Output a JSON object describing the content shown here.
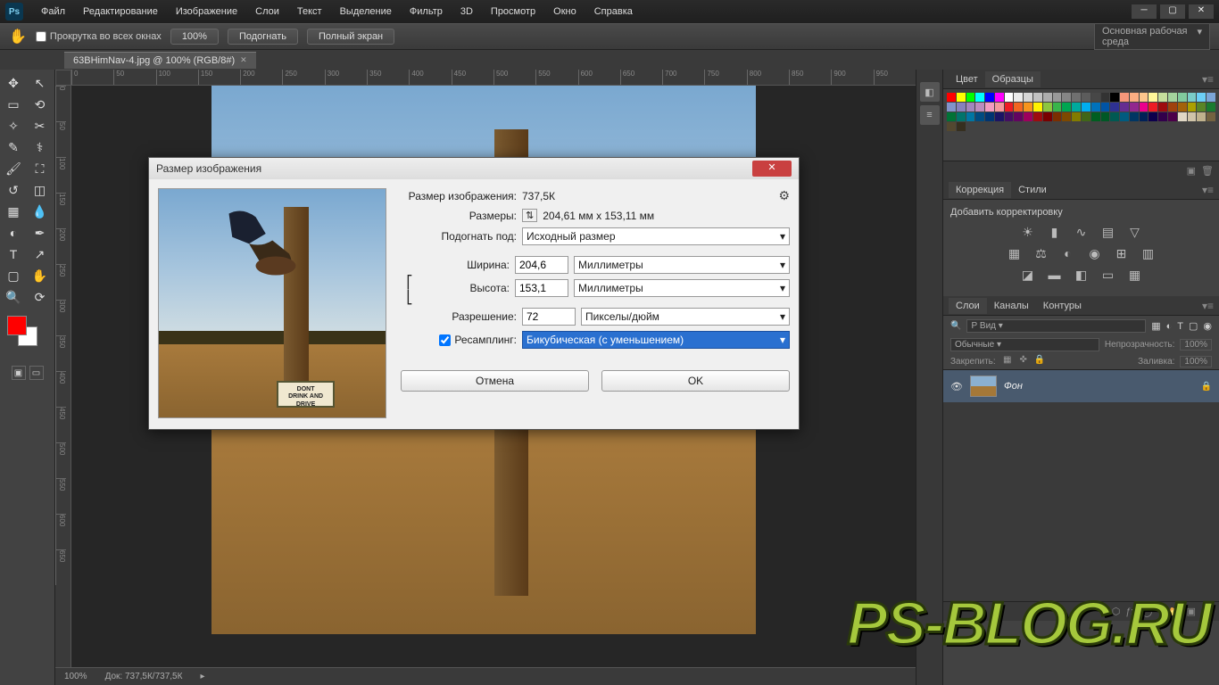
{
  "menubar": {
    "items": [
      "Файл",
      "Редактирование",
      "Изображение",
      "Слои",
      "Текст",
      "Выделение",
      "Фильтр",
      "3D",
      "Просмотр",
      "Окно",
      "Справка"
    ]
  },
  "optionsbar": {
    "scroll_all": "Прокрутка во всех окнах",
    "zoom_pct": "100%",
    "fit": "Подогнать",
    "fullscreen": "Полный экран",
    "workspace": "Основная рабочая среда"
  },
  "doctab": {
    "title": "63BHimNav-4.jpg @ 100% (RGB/8#)"
  },
  "statusbar": {
    "zoom": "100%",
    "doc": "Док: 737,5К/737,5К"
  },
  "panels": {
    "color_tabs": [
      "Цвет",
      "Образцы"
    ],
    "adjust_tabs": [
      "Коррекция",
      "Стили"
    ],
    "adjust_label": "Добавить корректировку",
    "layers_tabs": [
      "Слои",
      "Каналы",
      "Контуры"
    ],
    "layers": {
      "filter": "Р Вид",
      "blend": "Обычные",
      "opacity_label": "Непрозрачность:",
      "opacity": "100%",
      "lock_label": "Закрепить:",
      "fill_label": "Заливка:",
      "fill": "100%",
      "layer0": "Фон"
    }
  },
  "dialog": {
    "title": "Размер изображения",
    "size_label": "Размер изображения:",
    "size_val": "737,5К",
    "dims_label": "Размеры:",
    "dims_val": "204,61 мм x 153,11 мм",
    "fitto_label": "Подогнать под:",
    "fitto_val": "Исходный размер",
    "width_label": "Ширина:",
    "width_val": "204,6",
    "width_unit": "Миллиметры",
    "height_label": "Высота:",
    "height_val": "153,1",
    "height_unit": "Миллиметры",
    "res_label": "Разрешение:",
    "res_val": "72",
    "res_unit": "Пикселы/дюйм",
    "resample_label": "Ресамплинг:",
    "resample_val": "Бикубическая (с уменьшением)",
    "cancel": "Отмена",
    "ok": "OK"
  },
  "image_sign": "DONT\nDRINK AND\nDRIVE",
  "watermark": "PS-BLOG.RU",
  "swatch_colors": [
    "#ff0000",
    "#ffff00",
    "#00ff00",
    "#00ffff",
    "#0000ff",
    "#ff00ff",
    "#ffffff",
    "#ebebeb",
    "#d6d6d6",
    "#c2c2c2",
    "#adadad",
    "#999999",
    "#858585",
    "#707070",
    "#5c5c5c",
    "#474747",
    "#333333",
    "#000000",
    "#f7977a",
    "#fbad82",
    "#fdc68c",
    "#fff799",
    "#c6df9c",
    "#a4d49d",
    "#81ca9d",
    "#7accc8",
    "#6ccff7",
    "#7ca6d8",
    "#8293ca",
    "#8781bd",
    "#a286bd",
    "#bc8cbf",
    "#f49bc1",
    "#f5999d",
    "#ee1c24",
    "#f26522",
    "#f7941d",
    "#fff200",
    "#8cc63f",
    "#39b54a",
    "#00a651",
    "#00a99d",
    "#00aeef",
    "#0072bc",
    "#0054a6",
    "#2e3192",
    "#662d91",
    "#92278f",
    "#ec008c",
    "#ed1c24",
    "#9e0b0f",
    "#a0410d",
    "#a36209",
    "#aba000",
    "#598527",
    "#1a7b30",
    "#007236",
    "#00746b",
    "#0076a3",
    "#004b80",
    "#003471",
    "#1b1464",
    "#440e62",
    "#630460",
    "#9e005d",
    "#9e0b0f",
    "#790000",
    "#7b2e00",
    "#7d4900",
    "#827b00",
    "#406618",
    "#005e20",
    "#005826",
    "#005952",
    "#005b7f",
    "#003663",
    "#002157",
    "#0d004c",
    "#32004b",
    "#4b0049",
    "#e1d8c6",
    "#d0c4a9",
    "#c0b28e",
    "#746341",
    "#534830",
    "#362f1f"
  ]
}
